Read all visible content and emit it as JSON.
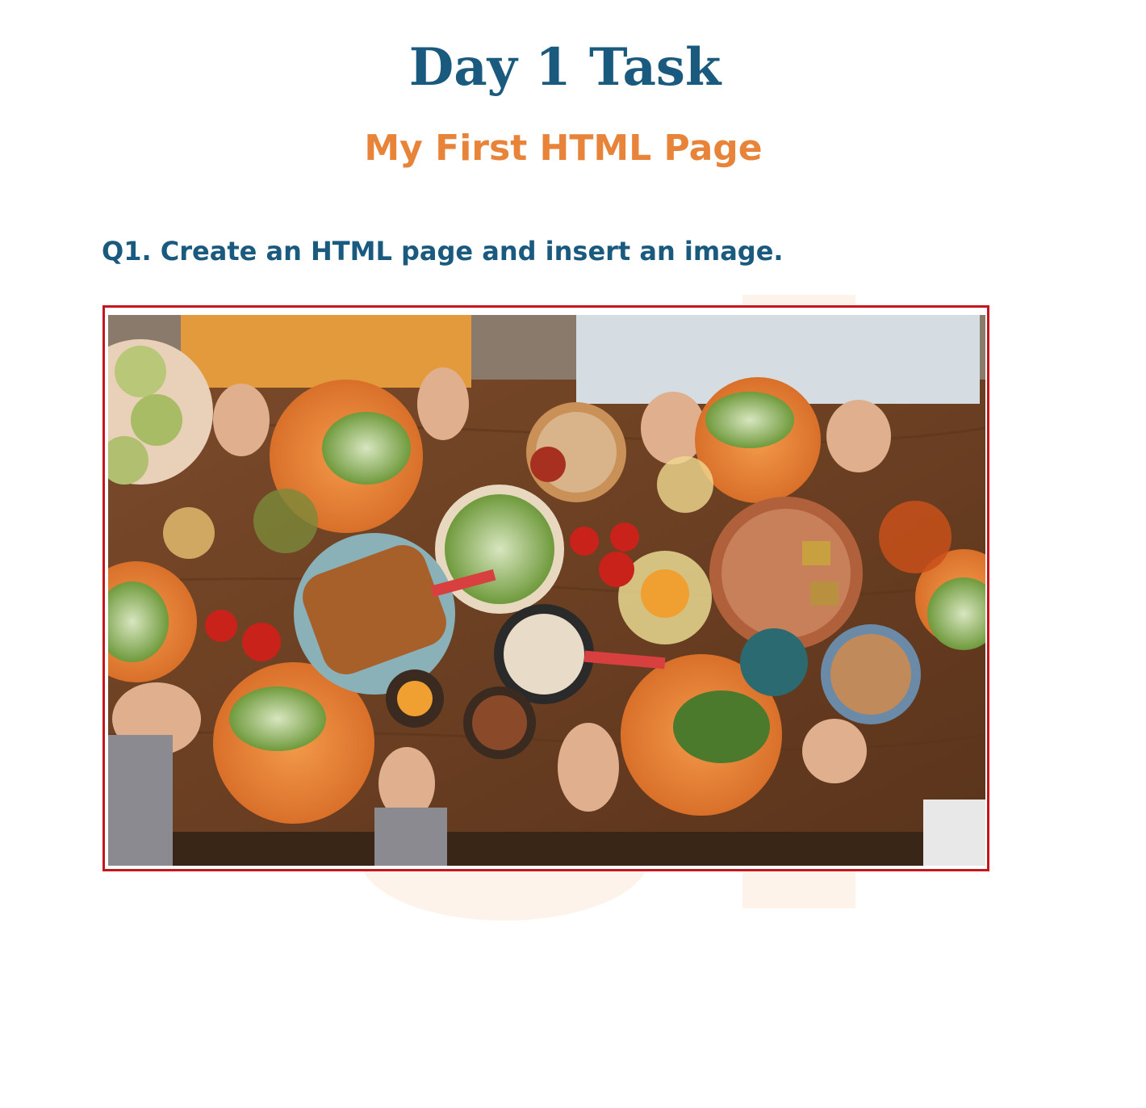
{
  "document": {
    "title": "Day 1 Task",
    "subtitle": "My First HTML Page",
    "question": "Q1. Create an HTML page and insert an image."
  },
  "photo": {
    "description_icon": "food-table-photo",
    "colors": {
      "frame_border": "#c4161c",
      "table_wood": "#6b4226",
      "plate_orange": "#e8832f",
      "title_blue": "#1b5a7f",
      "subtitle_orange": "#e8843a"
    }
  }
}
